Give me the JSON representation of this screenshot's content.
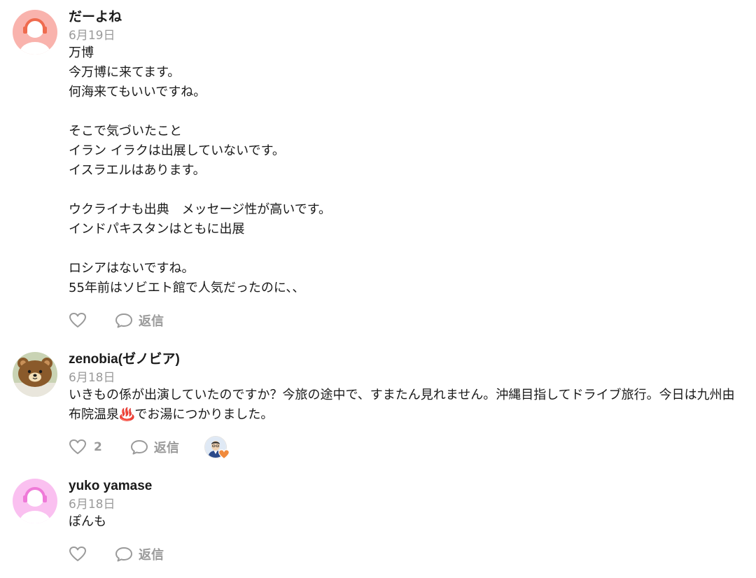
{
  "comments": [
    {
      "author": "だーよね",
      "date": "6月19日",
      "text": "万博\n今万博に来てます。\n何海来てもいいですね。\n\nそこで気づいたこと\nイラン イラクは出展していないです。\nイスラエルはあります。\n\nウクライナも出典　メッセージ性が高いです。\nインドパキスタンはともに出展\n\nロシアはないですね。\n55年前はソビエト館で人気だったのに、、",
      "avatar_icon": "default-avatar-orange",
      "like_count": "",
      "reply_label": "返信"
    },
    {
      "author": "zenobia(ゼノビア)",
      "date": "6月18日",
      "text": "いきもの係が出演していたのですか？今旅の途中で、すまたん見れません。沖縄目指してドライブ旅行。今日は九州由布院温泉♨️でお湯につかりました。",
      "avatar_icon": "bear-avatar",
      "like_count": "2",
      "reply_label": "返信",
      "liker_icon": "liker-avatar-with-heart"
    },
    {
      "author": "yuko yamase",
      "date": "6月18日",
      "text": "ぽんも",
      "avatar_icon": "default-avatar-pink",
      "like_count": "",
      "reply_label": "返信"
    }
  ],
  "colors": {
    "avatar_orange_bg": "#f9b3ad",
    "avatar_orange_fg": "#ef6b4f",
    "avatar_pink_bg": "#fac0f0",
    "avatar_pink_fg": "#ef7ad8",
    "muted": "#9a9a9a",
    "heart_accent": "#f08a3c"
  }
}
